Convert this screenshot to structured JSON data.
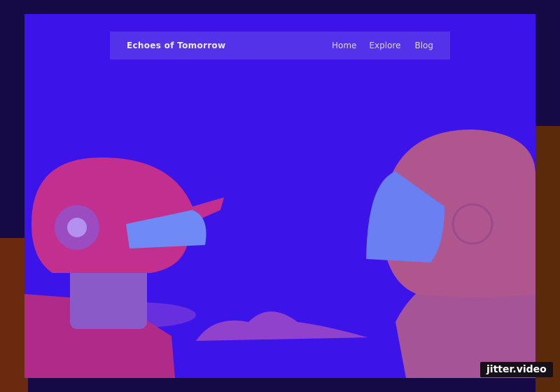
{
  "site": {
    "brand": "Echoes of Tomorrow"
  },
  "nav": {
    "links": [
      "Home",
      "Explore",
      "Blog"
    ]
  },
  "watermark": "jitter.video",
  "colors": {
    "background": "#150a45",
    "frame": "#3c14ea",
    "navbar": "#5432ea"
  }
}
